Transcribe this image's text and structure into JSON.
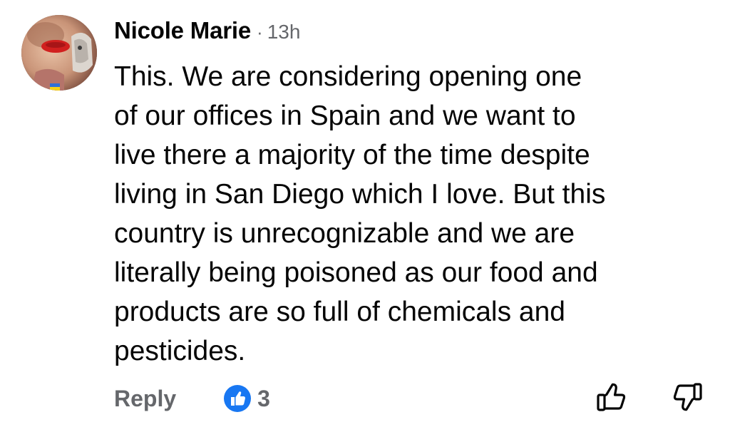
{
  "comment": {
    "author": "Nicole Marie",
    "separator": "·",
    "timestamp": "13h",
    "text": "This. We are considering opening one\nof our offices in Spain and we want to\nlive there a majority of the time despite\nliving in San Diego which I love. But this\ncountry is unrecognizable and we are\nliterally being poisoned as our food and\nproducts  are so full of chemicals and\npesticides.",
    "avatar_icon": "profile-photo"
  },
  "actions": {
    "reply_label": "Reply",
    "reaction_icon": "like-reaction-icon",
    "reaction_count": "3",
    "upvote_icon": "thumbs-up-outline-icon",
    "downvote_icon": "thumbs-down-outline-icon"
  },
  "colors": {
    "text_primary": "#050505",
    "text_secondary": "#65676b",
    "like_blue": "#1877f2"
  }
}
